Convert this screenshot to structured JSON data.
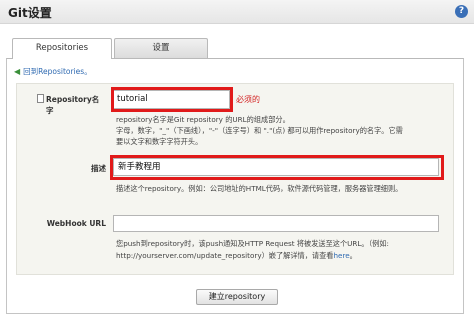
{
  "window": {
    "title": "Git设置",
    "help_icon": "?"
  },
  "tabs": [
    {
      "label": "Repositories"
    },
    {
      "label": "设置"
    }
  ],
  "back_link": "回到Repositories。",
  "form": {
    "repository_name": {
      "label": "Repository名字",
      "value": "tutorial",
      "required_text": "必须的",
      "hint_lines": [
        "repository名字是Git repository 的URL的组成部分。",
        "字母，数字，\"_\"（下画线），\"-\"（连字号）和 \".\"(点) 都可以用作repository的名字。它需",
        "要以文字和数字字符开头。"
      ]
    },
    "description": {
      "label": "描述",
      "value": "新手教程用",
      "hint": "描述这个repository。例如：公司地址的HTML代码，软件源代码管理，服务器管理细则。"
    },
    "webhook": {
      "label": "WebHook URL",
      "value": "",
      "hint_line1": "您push到repository时，该push通知及HTTP Request 将被发送至这个URL。（例如:",
      "hint_line2_prefix": "http://yourserver.com/update_repository）嵌了解详情，请查看",
      "hint_link": "here",
      "hint_line2_suffix": "。"
    }
  },
  "submit_label": "建立repository",
  "colors": {
    "highlight": "#e11a1a",
    "link": "#2f6ab1",
    "form_bg": "#f5f5f0"
  }
}
